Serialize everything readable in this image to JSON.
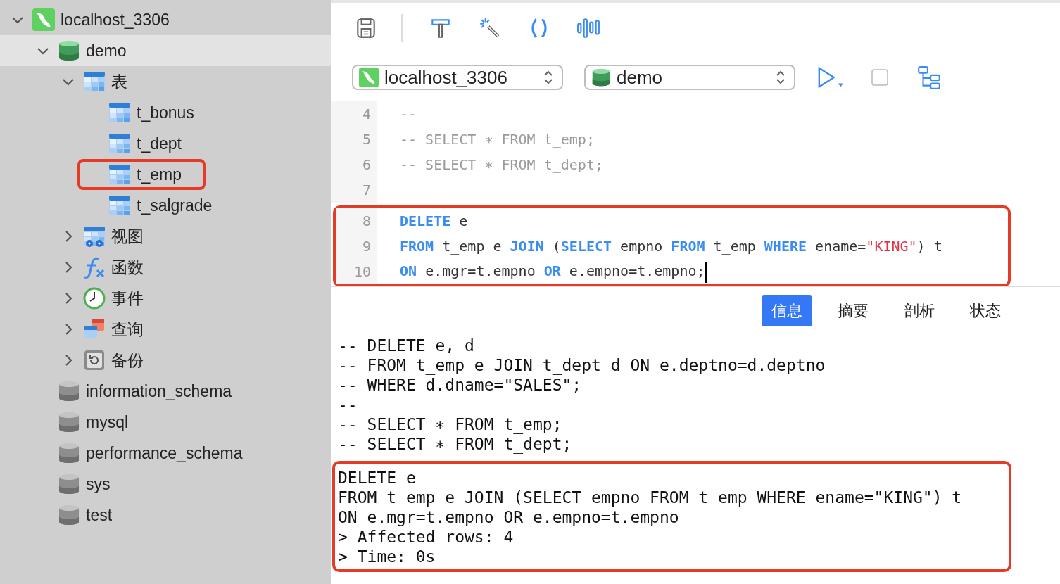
{
  "sidebar": {
    "tree": [
      {
        "label": "localhost_3306",
        "kind": "connection",
        "expanded": true,
        "selected": false,
        "highlighted": false,
        "children": [
          {
            "label": "demo",
            "kind": "database",
            "open": true,
            "expanded": true,
            "selected": true,
            "highlighted": false,
            "children": [
              {
                "label": "表",
                "kind": "table",
                "expanded": true,
                "selected": false,
                "highlighted": false,
                "children": [
                  {
                    "label": "t_bonus",
                    "kind": "table",
                    "selected": false,
                    "highlighted": false
                  },
                  {
                    "label": "t_dept",
                    "kind": "table",
                    "selected": false,
                    "highlighted": false
                  },
                  {
                    "label": "t_emp",
                    "kind": "table",
                    "selected": false,
                    "highlighted": true
                  },
                  {
                    "label": "t_salgrade",
                    "kind": "table",
                    "selected": false,
                    "highlighted": false
                  }
                ]
              },
              {
                "label": "视图",
                "kind": "view",
                "expanded": false,
                "selected": false,
                "highlighted": false
              },
              {
                "label": "函数",
                "kind": "function",
                "expanded": false,
                "selected": false,
                "highlighted": false
              },
              {
                "label": "事件",
                "kind": "event",
                "expanded": false,
                "selected": false,
                "highlighted": false
              },
              {
                "label": "查询",
                "kind": "query",
                "expanded": false,
                "selected": false,
                "highlighted": false
              },
              {
                "label": "备份",
                "kind": "backup",
                "expanded": false,
                "selected": false,
                "highlighted": false
              }
            ]
          },
          {
            "label": "information_schema",
            "kind": "database",
            "open": false,
            "selected": false,
            "highlighted": false
          },
          {
            "label": "mysql",
            "kind": "database",
            "open": false,
            "selected": false,
            "highlighted": false
          },
          {
            "label": "performance_schema",
            "kind": "database",
            "open": false,
            "selected": false,
            "highlighted": false
          },
          {
            "label": "sys",
            "kind": "database",
            "open": false,
            "selected": false,
            "highlighted": false
          },
          {
            "label": "test",
            "kind": "database",
            "open": false,
            "selected": false,
            "highlighted": false
          }
        ]
      }
    ]
  },
  "selectors": {
    "connection": "localhost_3306",
    "database": "demo",
    "stop_checked": false
  },
  "editor": {
    "lines": [
      {
        "number": "4",
        "tokens": [
          {
            "kind": "comment",
            "text": "--"
          }
        ]
      },
      {
        "number": "5",
        "tokens": [
          {
            "kind": "comment",
            "text": "-- SELECT ∗ FROM t_emp;"
          }
        ]
      },
      {
        "number": "6",
        "tokens": [
          {
            "kind": "comment",
            "text": "-- SELECT ∗ FROM t_dept;"
          }
        ]
      },
      {
        "number": "7"
      }
    ],
    "highlight_frame": {
      "lines": [
        {
          "number": "8",
          "tokens": [
            {
              "kind": "keyword",
              "text": "DELETE"
            },
            {
              "kind": "plain",
              "text": " e"
            }
          ]
        },
        {
          "number": "9",
          "tokens": [
            {
              "kind": "keyword",
              "text": "FROM"
            },
            {
              "kind": "plain",
              "text": " t_emp e "
            },
            {
              "kind": "keyword",
              "text": "JOIN"
            },
            {
              "kind": "plain",
              "text": " ("
            },
            {
              "kind": "keyword",
              "text": "SELECT"
            },
            {
              "kind": "plain",
              "text": " empno "
            },
            {
              "kind": "keyword",
              "text": "FROM"
            },
            {
              "kind": "plain",
              "text": " t_emp "
            },
            {
              "kind": "keyword",
              "text": "WHERE"
            },
            {
              "kind": "plain",
              "text": " ename="
            },
            {
              "kind": "string",
              "text": "\"KING\""
            },
            {
              "kind": "plain",
              "text": ") t"
            }
          ]
        },
        {
          "number": "10",
          "cursor": true,
          "tokens": [
            {
              "kind": "keyword",
              "text": "ON"
            },
            {
              "kind": "plain",
              "text": " e.mgr=t.empno "
            },
            {
              "kind": "keyword",
              "text": "OR"
            },
            {
              "kind": "plain",
              "text": " e.empno=t.empno;"
            }
          ]
        }
      ]
    }
  },
  "result_tabs": [
    {
      "label": "信息",
      "selected": true
    },
    {
      "label": "摘要",
      "selected": false
    },
    {
      "label": "剖析",
      "selected": false
    },
    {
      "label": "状态",
      "selected": false
    }
  ],
  "output": {
    "lines": [
      "-- DELETE e, d",
      "-- FROM t_emp e JOIN t_dept d ON e.deptno=d.deptno",
      "-- WHERE d.dname=\"SALES\";",
      "--",
      "-- SELECT ∗ FROM t_emp;",
      "-- SELECT ∗ FROM t_dept;"
    ],
    "highlight_frame": {
      "lines": [
        "DELETE e",
        "FROM t_emp e JOIN (SELECT empno FROM t_emp WHERE ename=\"KING\") t",
        "ON e.mgr=t.empno OR e.empno=t.empno",
        "> Affected rows: 4",
        "> Time: 0s"
      ]
    }
  }
}
